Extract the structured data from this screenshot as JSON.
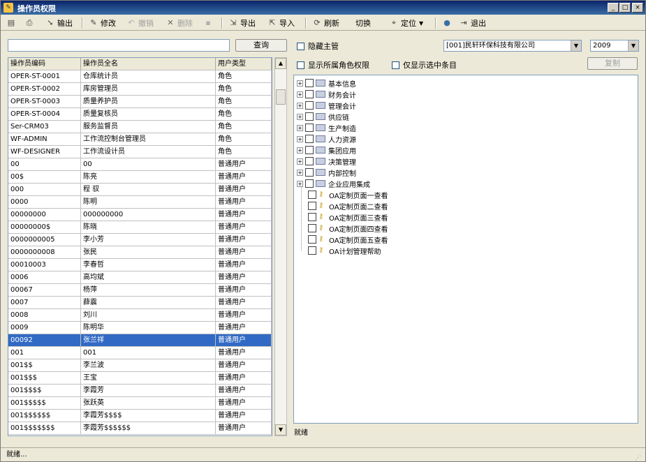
{
  "window": {
    "title": "操作员权限",
    "controls": [
      "_",
      "□",
      "×"
    ]
  },
  "toolbar": {
    "items": [
      {
        "label": "",
        "icon": "save-icon",
        "disabled": false
      },
      {
        "label": "",
        "icon": "print-icon",
        "disabled": false
      },
      {
        "label": "输出",
        "icon": "export-icon",
        "disabled": false
      },
      {
        "label": "修改",
        "icon": "edit-icon",
        "disabled": false
      },
      {
        "label": "撤销",
        "icon": "undo-icon",
        "disabled": true
      },
      {
        "label": "删除",
        "icon": "delete-icon",
        "disabled": true
      },
      {
        "label": "",
        "icon": "floppy-icon",
        "disabled": true
      },
      {
        "label": "导出",
        "icon": "export-out-icon",
        "disabled": false
      },
      {
        "label": "导入",
        "icon": "import-icon",
        "disabled": false
      },
      {
        "label": "刷新",
        "icon": "refresh-icon",
        "disabled": false
      },
      {
        "label": "切换",
        "icon": "switch-icon",
        "disabled": false
      },
      {
        "label": "定位",
        "icon": "locate-icon",
        "disabled": false
      },
      {
        "label": "",
        "icon": "help-icon",
        "disabled": false
      },
      {
        "label": "退出",
        "icon": "exit-icon",
        "disabled": false
      }
    ]
  },
  "search": {
    "value": "",
    "button_label": "查询"
  },
  "options": {
    "hide_supervisor": "隐藏主管",
    "show_role_rights": "显示所属角色权限",
    "show_selected_only": "仅显示选中条目",
    "company_value": "[001]民轩环保科技有限公司",
    "year_value": "2009",
    "modify_label": "复制"
  },
  "grid": {
    "columns": [
      "操作员编码",
      "操作员全名",
      "用户类型"
    ],
    "rows": [
      [
        "OPER-ST-0001",
        "仓库统计员",
        "角色"
      ],
      [
        "OPER-ST-0002",
        "库房管理员",
        "角色"
      ],
      [
        "OPER-ST-0003",
        "质量养护员",
        "角色"
      ],
      [
        "OPER-ST-0004",
        "质量复核员",
        "角色"
      ],
      [
        "Ser-CRM03",
        "服务监督员",
        "角色"
      ],
      [
        "WF-ADMIN",
        "工作流控制台管理员",
        "角色"
      ],
      [
        "WF-DESIGNER",
        "工作流设计员",
        "角色"
      ],
      [
        "00",
        "00",
        "普通用户"
      ],
      [
        "00$",
        "陈亮",
        "普通用户"
      ],
      [
        "000",
        "程 驭",
        "普通用户"
      ],
      [
        "0000",
        "陈明",
        "普通用户"
      ],
      [
        "00000000",
        "000000000",
        "普通用户"
      ],
      [
        "00000000$",
        "陈晓",
        "普通用户"
      ],
      [
        "0000000005",
        "李小芳",
        "普通用户"
      ],
      [
        "0000000008",
        "张民",
        "普通用户"
      ],
      [
        "00010003",
        "李春哲",
        "普通用户"
      ],
      [
        "0006",
        "高均斌",
        "普通用户"
      ],
      [
        "00067",
        "杨萍",
        "普通用户"
      ],
      [
        "0007",
        "薛震",
        "普通用户"
      ],
      [
        "0008",
        "刘川",
        "普通用户"
      ],
      [
        "0009",
        "陈明华",
        "普通用户"
      ],
      [
        "00092",
        "张兰祥",
        "普通用户"
      ],
      [
        "001",
        "001",
        "普通用户"
      ],
      [
        "001$$",
        "李兰波",
        "普通用户"
      ],
      [
        "001$$$",
        "王宝",
        "普通用户"
      ],
      [
        "001$$$$",
        "李霞芳",
        "普通用户"
      ],
      [
        "001$$$$$",
        "张跃英",
        "普通用户"
      ],
      [
        "001$$$$$$",
        "李霞芳$$$$",
        "普通用户"
      ],
      [
        "001$$$$$$$",
        "李霞芳$$$$$$",
        "普通用户"
      ]
    ],
    "selected_index": 21
  },
  "tree": {
    "groups": [
      "基本信息",
      "财务会计",
      "管理会计",
      "供应链",
      "生产制造",
      "人力资源",
      "集团应用",
      "决策管理",
      "内部控制",
      "企业应用集成"
    ],
    "children": [
      "OA定制页面一查看",
      "OA定制页面二查看",
      "OA定制页面三查看",
      "OA定制页面四查看",
      "OA定制页面五查看",
      "OA计划管理帮助"
    ]
  },
  "tree_footer": "就绪",
  "status": {
    "text": "就绪..."
  }
}
